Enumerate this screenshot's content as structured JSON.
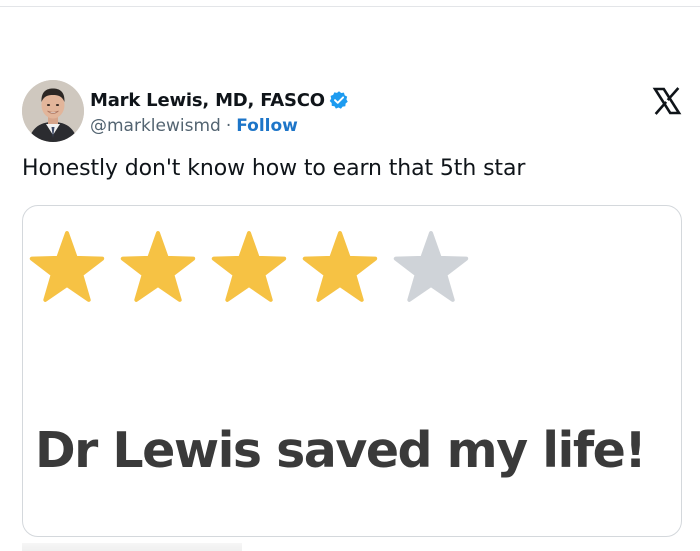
{
  "tweet": {
    "author_name": "Mark Lewis, MD, FASCO",
    "handle": "@marklewismd",
    "separator": "·",
    "follow_label": "Follow",
    "text": "Honestly don't know how to earn that 5th star",
    "verified_badge_color": "#1d9bf0"
  },
  "media": {
    "rating": {
      "filled": 4,
      "total": 5
    },
    "review_text": "Dr Lewis saved my life!",
    "star_filled_color": "#f6c244",
    "star_empty_color": "#cfd3d8"
  },
  "icons": {
    "platform": "x-logo-icon",
    "verified": "verified-badge-icon"
  }
}
